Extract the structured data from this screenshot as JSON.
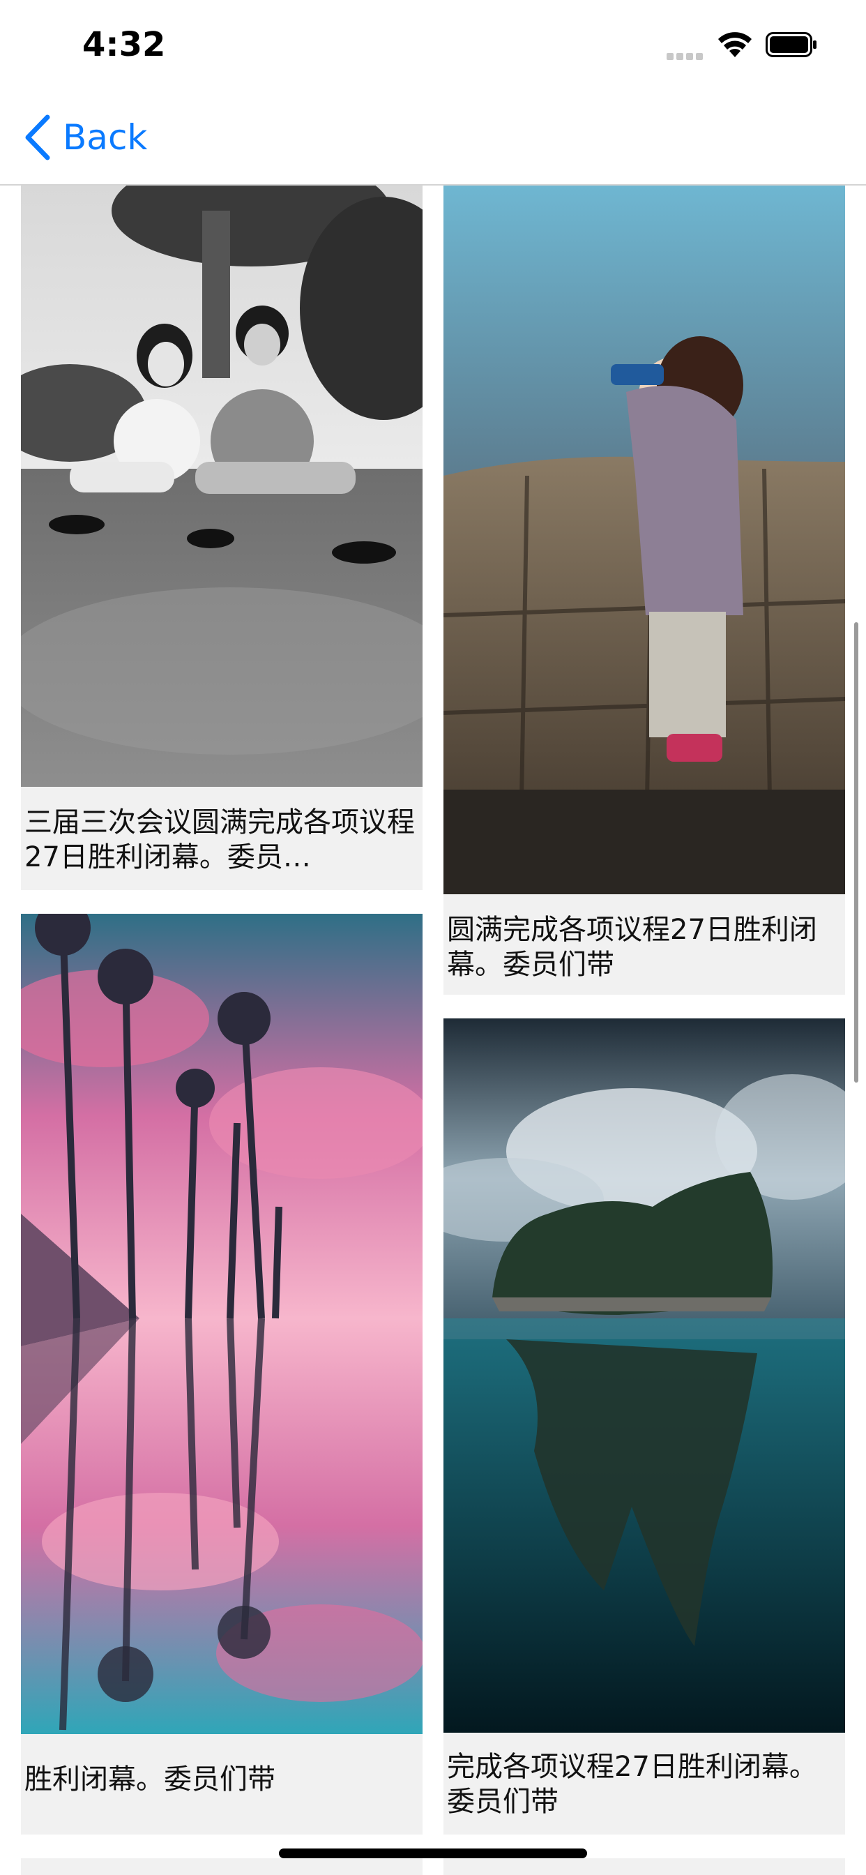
{
  "status_bar": {
    "time": "4:32"
  },
  "nav": {
    "back_label": "Back"
  },
  "cards": [
    {
      "caption": "三届三次会议圆满完成各项议程27日胜利闭幕。委员…",
      "image": "black-and-white photo of a couple sitting on grass under trees"
    },
    {
      "caption": "圆满完成各项议程27日胜利闭幕。委员们带",
      "image": "child in knit sweater looking through binoculars over stone wall"
    },
    {
      "caption": "胜利闭幕。委员们带",
      "image": "palm trees under pink clouds reflected in water"
    },
    {
      "caption": "完成各项议程27日胜利闭幕。委员们带",
      "image": "rocky island floating over sea with skull-like reflection"
    }
  ],
  "colors": {
    "accent": "#0a7aff",
    "card_bg": "#f1f1f1",
    "text": "#111111"
  }
}
